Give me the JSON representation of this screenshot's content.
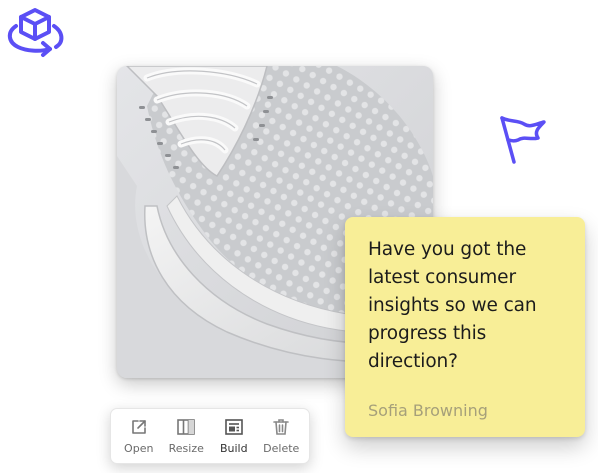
{
  "note": {
    "text": "Have you got the\nlatest consumer\ninsights so we can\nprogress this\ndirection?",
    "author": "Sofia Browning"
  },
  "toolbar": {
    "items": [
      {
        "label": "Open",
        "icon": "open-external-icon"
      },
      {
        "label": "Resize",
        "icon": "resize-icon"
      },
      {
        "label": "Build",
        "icon": "build-icon"
      },
      {
        "label": "Delete",
        "icon": "trash-icon"
      }
    ]
  },
  "colors": {
    "accent": "#5b4ff5",
    "note_background": "#f8ee97",
    "author_text": "#a6a07a"
  },
  "decorations": {
    "top_left_icon": "cube-rotate-icon",
    "right_icon": "flag-icon"
  }
}
